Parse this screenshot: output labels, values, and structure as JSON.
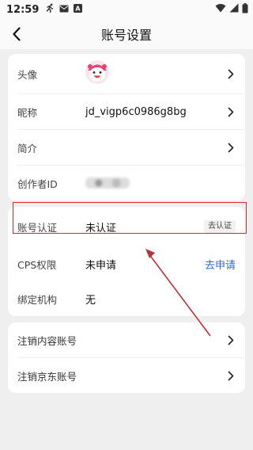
{
  "status_bar": {
    "time": "12:59",
    "left_icons": [
      "running-icon",
      "mail-icon",
      "a-icon"
    ],
    "right_icons": [
      "wifi-icon",
      "signal-icon",
      "battery-icon"
    ]
  },
  "nav": {
    "title": "账号设置",
    "back_icon": "chevron-left-icon"
  },
  "profile_card": {
    "avatar_label": "头像",
    "nickname_label": "昵称",
    "nickname_value": "jd_vigp6c0986g8bg",
    "intro_label": "简介",
    "creator_id_label": "创作者ID"
  },
  "auth_card": {
    "account_auth_label": "账号认证",
    "account_auth_value": "未认证",
    "account_auth_action": "去认证",
    "cps_label": "CPS权限",
    "cps_value": "未申请",
    "cps_action": "去申请",
    "bind_org_label": "绑定机构",
    "bind_org_value": "无"
  },
  "account_card": {
    "cancel_content_label": "注销内容账号",
    "cancel_jd_label": "注销京东账号"
  },
  "colors": {
    "background": "#efefef",
    "card": "#ffffff",
    "link": "#2f6bd8",
    "highlight": "#d9272e",
    "arrow": "#b5343a"
  }
}
